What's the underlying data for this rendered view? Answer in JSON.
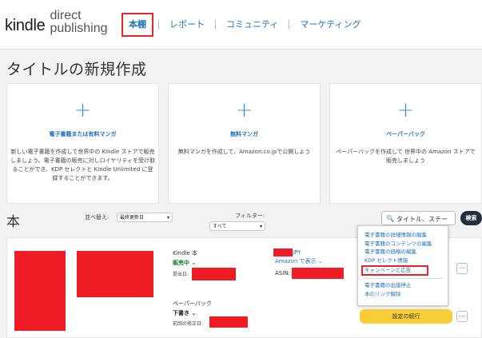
{
  "header": {
    "logo_kindle": "kindle",
    "logo_direct": "direct",
    "logo_publishing": "publishing",
    "nav": [
      "本棚",
      "レポート",
      "コミュニティ",
      "マーケティング"
    ]
  },
  "page_title": "タイトルの新規作成",
  "create_cards": [
    {
      "title": "電子書籍または有料マンガ",
      "desc": "新しい電子書籍を作成して世界中の Kindle ストアで販売しましょう。電子書籍の販売に対しロイヤリティを受け取ることができ、KDP セレクトと Kindle Unlimited に登録することができます。"
    },
    {
      "title": "無料マンガ",
      "desc": "無料マンガを作成して、Amazon.co.jpで公開しよう"
    },
    {
      "title": "ペーパーバック",
      "desc": "ペーパーバックを作成して 世界中の Amazon ストアで販売しましょう"
    }
  ],
  "library": {
    "title": "本",
    "sort_label": "並べ替え:",
    "sort_value": "最終更新日",
    "filter_label": "フィルター:",
    "filter_value": "すべて",
    "search_placeholder": "タイトル、ステー",
    "search_button": "検索"
  },
  "book": {
    "kindle": {
      "format": "Kindle 本",
      "status": "販売中 ⌄",
      "date_label": "提出日:",
      "price_suffix": "JPY",
      "amazon_link": "Amazon で表示 ⌄",
      "asin_label": "ASIN:"
    },
    "paperback": {
      "format": "ペーパーバック",
      "status": "下書き ⌄",
      "date_label": "前回の修正日:",
      "continue_button": "設定の続行"
    },
    "more_label": "..."
  },
  "dropdown": {
    "items_top": [
      "電子書籍の詳細情報の編集",
      "電子書籍のコンテンツの編集",
      "電子書籍の価格の編集",
      "KDP セレクト情報"
    ],
    "highlighted": "キャンペーンと広告",
    "items_bottom": [
      "電子書籍の出版停止",
      "本のリンク解除"
    ]
  },
  "colors": {
    "accent": "#1e70b8",
    "highlight_border": "#e8232a",
    "status_live": "#147a2e",
    "primary_button": "#f9cd35",
    "search_button": "#232f3e"
  }
}
